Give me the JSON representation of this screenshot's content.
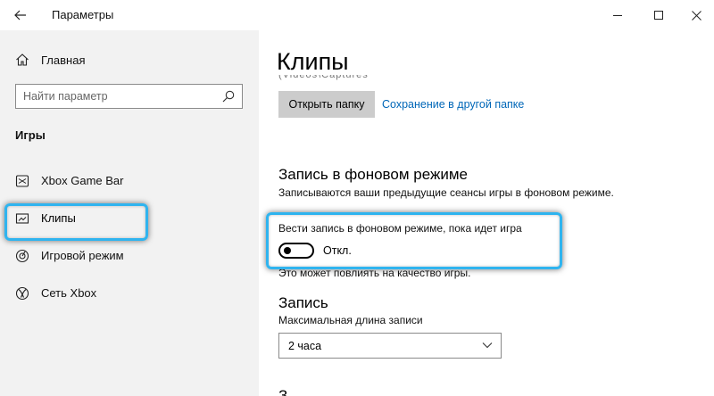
{
  "window": {
    "title": "Параметры",
    "controls": [
      "minimize",
      "maximize",
      "close"
    ]
  },
  "sidebar": {
    "home_label": "Главная",
    "search_placeholder": "Найти параметр",
    "section_header": "Игры",
    "items": [
      {
        "label": "Xbox Game Bar",
        "icon": "xbox-game-bar-icon",
        "selected": false
      },
      {
        "label": "Клипы",
        "icon": "clips-icon",
        "selected": true
      },
      {
        "label": "Игровой режим",
        "icon": "game-mode-icon",
        "selected": false
      },
      {
        "label": "Сеть Xbox",
        "icon": "xbox-network-icon",
        "selected": false
      }
    ]
  },
  "main": {
    "page_title": "Клипы",
    "cut_text": "(Videos\\Captures",
    "open_folder_button": "Открыть папку",
    "save_elsewhere_link": "Сохранение в другой папке",
    "background_recording": {
      "heading": "Запись в фоновом режиме",
      "description": "Записываются ваши предыдущие сеансы игры в фоновом режиме.",
      "toggle_label": "Вести запись в фоновом режиме, пока идет игра",
      "toggle_on": false,
      "toggle_state": "Откл.",
      "note": "Это может повлиять на качество игры."
    },
    "recording": {
      "heading": "Запись",
      "max_length_label": "Максимальная длина записи",
      "max_length_value": "2 часа"
    },
    "next_heading_partial": "З"
  },
  "colors": {
    "sidebar_bg": "#f2f2f2",
    "link": "#0067b8",
    "button_bg": "#cccccc",
    "highlight": "#2fb4ef"
  }
}
